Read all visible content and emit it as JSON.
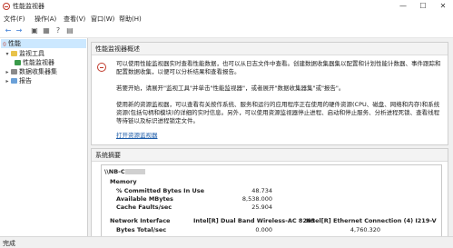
{
  "window": {
    "title": "性能监视器",
    "controls": {
      "minimize": "—",
      "maximize": "☐",
      "close": "✕"
    }
  },
  "menu": {
    "items": [
      "文件(F)",
      "操作(A)",
      "查看(V)",
      "窗口(W)",
      "帮助(H)"
    ]
  },
  "toolbar": {
    "buttons": [
      "back-icon",
      "forward-icon",
      "up-icon",
      "grid-icon",
      "help-icon",
      "panel-icon"
    ]
  },
  "tree": {
    "root": "性能",
    "items": [
      {
        "label": "监视工具",
        "expanded": true
      },
      {
        "label": "性能监视器"
      },
      {
        "label": "数据收集器集",
        "expanded": false
      },
      {
        "label": "报告",
        "expanded": false
      }
    ]
  },
  "overview": {
    "title": "性能监视器概述",
    "p1": "可以使用性能监视器实时查看性能数据，也可以从日志文件中查看。创建数据收集器集以配置和计划性能计数器、事件跟踪和配置数据收集，以便可以分析结果和查看报告。",
    "p2": "若要开始，请展开\"监视工具\"并单击\"性能监视器\"，或者展开\"数据收集器集\"或\"报告\"。",
    "p3": "使用新的资源监视器，可以查看有关按作系统、服务和运行的应用程序正在使用的硬件资源(CPU、磁盘、网络和内存)和系统资源(包括句柄和模块)的详细的实时信息。另外，可以使用资源监视器停止进程、启动和停止服务、分析进程死锁、查看线程等待链以及标识进程锁定文件。",
    "link": "打开资源监视器"
  },
  "summary": {
    "title": "系统摘要",
    "computer": "\\\\NB-C",
    "memory": {
      "header": "Memory",
      "rows": [
        {
          "name": "% Committed Bytes In Use",
          "value": "48.734"
        },
        {
          "name": "Available MBytes",
          "value": "8,538.000"
        },
        {
          "name": "Cache Faults/sec",
          "value": "25.904"
        }
      ]
    },
    "network": {
      "header": "Network Interface",
      "col1": "Intel[R] Dual Band Wireless-AC 8265",
      "col2": "Intel[R] Ethernet Connection (4) I219-V",
      "row": {
        "name": "Bytes Total/sec",
        "v1": "0.000",
        "v2": "4,760.320"
      }
    }
  },
  "status": {
    "text": "完成"
  }
}
